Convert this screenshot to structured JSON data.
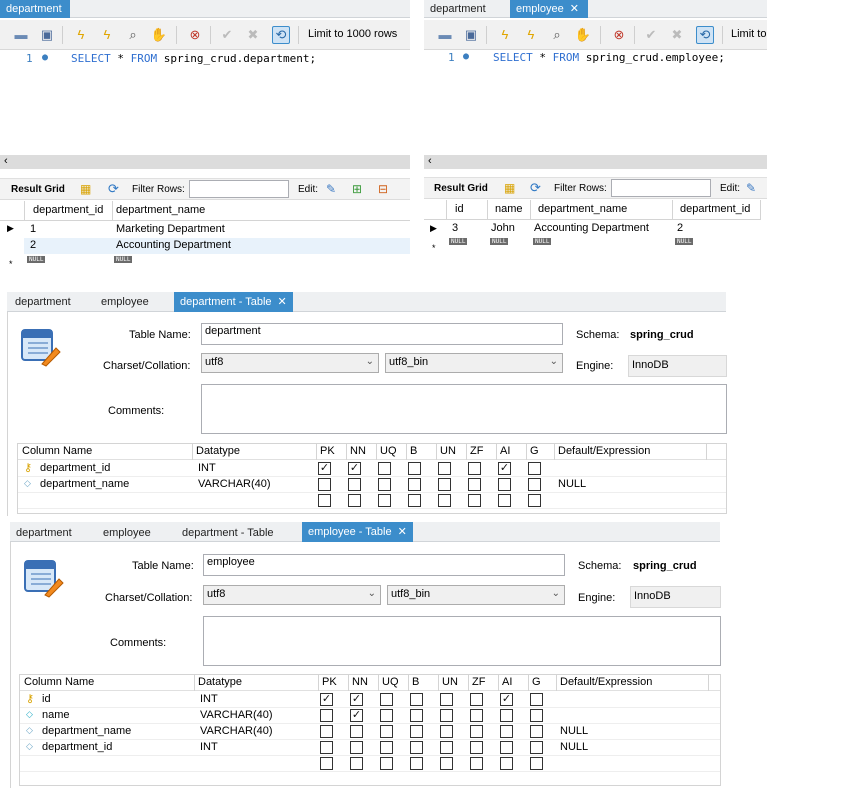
{
  "top_left": {
    "tabs": [
      {
        "label": "department",
        "active": true
      }
    ],
    "limit_label": "Limit to 1000 rows",
    "line_number": "1",
    "sql": {
      "select": "SELECT",
      "star": "*",
      "from": "FROM",
      "rest": "spring_crud.department;"
    },
    "result_grid": {
      "label": "Result Grid",
      "filter_label": "Filter Rows:",
      "edit_label": "Edit:"
    },
    "columns": [
      "department_id",
      "department_name"
    ],
    "rows": [
      [
        "1",
        "Marketing Department"
      ],
      [
        "2",
        "Accounting Department"
      ]
    ],
    "null_label": "NULL",
    "new_row_marker": "*"
  },
  "top_right": {
    "tabs": [
      {
        "label": "department",
        "active": false
      },
      {
        "label": "employee",
        "active": true
      }
    ],
    "limit_label": "Limit to",
    "line_number": "1",
    "sql": {
      "select": "SELECT",
      "star": "*",
      "from": "FROM",
      "rest": "spring_crud.employee;"
    },
    "result_grid": {
      "label": "Result Grid",
      "filter_label": "Filter Rows:",
      "edit_label": "Edit:"
    },
    "columns": [
      "id",
      "name",
      "department_name",
      "department_id"
    ],
    "rows": [
      [
        "3",
        "John",
        "Accounting Department",
        "2"
      ]
    ],
    "null_label": "NULL",
    "new_row_marker": "*"
  },
  "dept_table": {
    "tabs": [
      {
        "label": "department"
      },
      {
        "label": "employee"
      },
      {
        "label": "department - Table",
        "active": true
      }
    ],
    "table_name_label": "Table Name:",
    "table_name": "department",
    "schema_label": "Schema:",
    "schema": "spring_crud",
    "charset_label": "Charset/Collation:",
    "charset": "utf8",
    "collation": "utf8_bin",
    "engine_label": "Engine:",
    "engine": "InnoDB",
    "comments_label": "Comments:",
    "col_headers": [
      "Column Name",
      "Datatype",
      "PK",
      "NN",
      "UQ",
      "B",
      "UN",
      "ZF",
      "AI",
      "G",
      "Default/Expression"
    ],
    "columns": [
      {
        "name": "department_id",
        "type": "INT",
        "key": true,
        "flags": [
          true,
          true,
          false,
          false,
          false,
          false,
          true,
          false
        ],
        "default": ""
      },
      {
        "name": "department_name",
        "type": "VARCHAR(40)",
        "key": false,
        "flags": [
          false,
          false,
          false,
          false,
          false,
          false,
          false,
          false
        ],
        "default": "NULL"
      }
    ]
  },
  "emp_table": {
    "tabs": [
      {
        "label": "department"
      },
      {
        "label": "employee"
      },
      {
        "label": "department - Table"
      },
      {
        "label": "employee - Table",
        "active": true
      }
    ],
    "table_name_label": "Table Name:",
    "table_name": "employee",
    "schema_label": "Schema:",
    "schema": "spring_crud",
    "charset_label": "Charset/Collation:",
    "charset": "utf8",
    "collation": "utf8_bin",
    "engine_label": "Engine:",
    "engine": "InnoDB",
    "comments_label": "Comments:",
    "col_headers": [
      "Column Name",
      "Datatype",
      "PK",
      "NN",
      "UQ",
      "B",
      "UN",
      "ZF",
      "AI",
      "G",
      "Default/Expression"
    ],
    "columns": [
      {
        "name": "id",
        "type": "INT",
        "key": true,
        "flags": [
          true,
          true,
          false,
          false,
          false,
          false,
          true,
          false
        ],
        "default": ""
      },
      {
        "name": "name",
        "type": "VARCHAR(40)",
        "key": false,
        "flags": [
          false,
          true,
          false,
          false,
          false,
          false,
          false,
          false
        ],
        "default": ""
      },
      {
        "name": "department_name",
        "type": "VARCHAR(40)",
        "key": false,
        "flags": [
          false,
          false,
          false,
          false,
          false,
          false,
          false,
          false
        ],
        "default": "NULL"
      },
      {
        "name": "department_id",
        "type": "INT",
        "key": false,
        "flags": [
          false,
          false,
          false,
          false,
          false,
          false,
          false,
          false
        ],
        "default": "NULL"
      }
    ]
  },
  "colors": {
    "active_tab": "#3c8dcb",
    "keyword": "#2f6fd0",
    "grid_line": "#d4d4d4"
  }
}
